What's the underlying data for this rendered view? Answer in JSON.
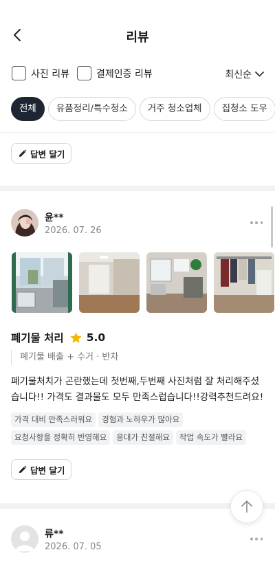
{
  "header": {
    "title": "리뷰",
    "back_icon": "chevron-left-icon"
  },
  "filters": {
    "photo_review_label": "사진 리뷰",
    "photo_review_checked": false,
    "verified_review_label": "결제인증 리뷰",
    "verified_review_checked": false,
    "sort_label": "최신순",
    "sort_icon": "chevron-down-icon"
  },
  "categories": [
    {
      "label": "전체",
      "active": true
    },
    {
      "label": "유품정리/특수청소",
      "active": false
    },
    {
      "label": "거주 청소업체",
      "active": false
    },
    {
      "label": "집청소 도우",
      "active": false
    }
  ],
  "reply_button_label": "답변 달기",
  "reviews": [
    {
      "name": "윤**",
      "date": "2026. 07. 26",
      "photo_count_visible": 4,
      "service": "폐기물 처리",
      "rating": "5.0",
      "detail": "폐기물 배출 + 수거 · 반차",
      "text": "폐기물처치가 곤란했는데 첫번째,두번째 사진처럼 잘 처리해주셨습니다!! 가격도 결과물도 모두 만족스럽습니다!!강력추천드려요!",
      "tags_row1": [
        "가격 대비 만족스러워요",
        "경험과 노하우가 많아요"
      ],
      "tags_row2": [
        "요청사항을 정확히 반영해요",
        "응대가 친절해요",
        "작업 속도가 빨라요"
      ],
      "reply_label": "답변 달기"
    },
    {
      "name": "류**",
      "date": "2026. 07. 05"
    }
  ],
  "colors": {
    "active_chip": "#1f2633",
    "star": "#f5b800",
    "tag_bg": "#f1f2f4"
  },
  "scroll_top_icon": "arrow-up-icon"
}
